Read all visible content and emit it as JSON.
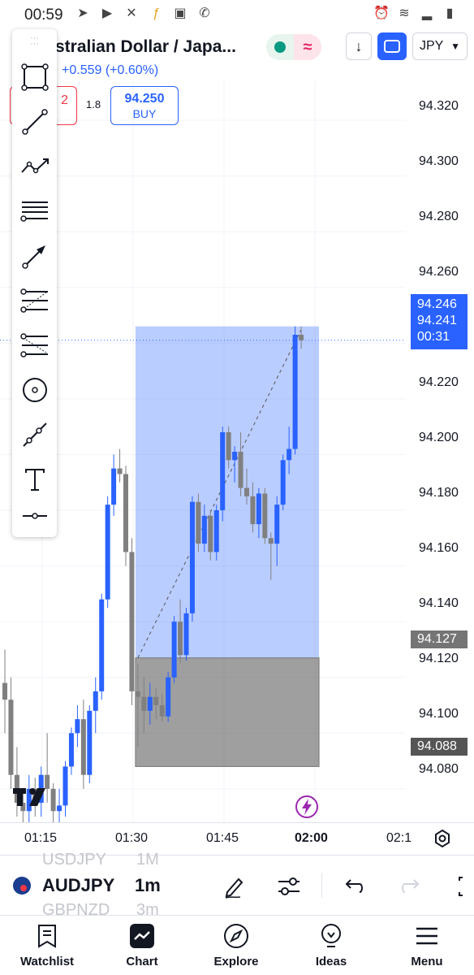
{
  "status": {
    "time": "00:59",
    "left_icons": [
      "telegram-icon",
      "youtube-icon",
      "x-icon",
      "fx-icon",
      "gallery-icon",
      "whatsapp-icon"
    ],
    "right_icons": [
      "alarm-icon",
      "wifi-icon",
      "signal-icon",
      "battery-icon"
    ]
  },
  "header": {
    "symbol_title": "Australian Dollar / Japa...",
    "change": "+0.559 (+0.60%)",
    "currency": "JPY",
    "sell_partial": "2",
    "spread": "1.8",
    "buy_price": "94.250",
    "buy_label": "BUY"
  },
  "toolbar": {
    "tools": [
      "rectangle-tool-icon",
      "trend-line-tool-icon",
      "path-tool-icon",
      "horizontal-lines-tool-icon",
      "arrow-tool-icon",
      "fib-retracement-tool-icon",
      "fib-extension-tool-icon",
      "circle-tool-icon",
      "ray-tool-icon",
      "text-tool-icon",
      "horizontal-ray-tool-icon"
    ]
  },
  "price_axis": {
    "labels": [
      "94.320",
      "94.300",
      "94.280",
      "94.260",
      "94.220",
      "94.200",
      "94.180",
      "94.160",
      "94.140",
      "94.120",
      "94.100",
      "94.080"
    ],
    "tag_high": "94.246",
    "tag_last": "94.241",
    "tag_countdown": "00:31",
    "tag_entry": "94.127",
    "tag_stop": "94.088"
  },
  "time_axis": {
    "labels": [
      "01:15",
      "01:30",
      "01:45",
      "02:00",
      "02:1"
    ]
  },
  "chart_data": {
    "type": "candlestick",
    "interval": "1m",
    "y_range": [
      94.068,
      94.334
    ],
    "up_color": "#2962ff",
    "down_color": "#808080",
    "candles": [
      [
        94.118,
        94.13,
        94.1,
        94.112
      ],
      [
        94.112,
        94.12,
        94.08,
        94.085
      ],
      [
        94.085,
        94.095,
        94.07,
        94.075
      ],
      [
        94.075,
        94.08,
        94.068,
        94.072
      ],
      [
        94.072,
        94.085,
        94.068,
        94.08
      ],
      [
        94.08,
        94.084,
        94.07,
        94.075
      ],
      [
        94.075,
        94.088,
        94.07,
        94.085
      ],
      [
        94.085,
        94.1,
        94.075,
        94.08
      ],
      [
        94.08,
        94.082,
        94.068,
        94.072
      ],
      [
        94.072,
        94.08,
        94.068,
        94.074
      ],
      [
        94.074,
        94.09,
        94.07,
        94.088
      ],
      [
        94.088,
        94.102,
        94.085,
        94.1
      ],
      [
        94.1,
        94.11,
        94.095,
        94.105
      ],
      [
        94.105,
        94.112,
        94.08,
        94.085
      ],
      [
        94.085,
        94.11,
        94.082,
        94.108
      ],
      [
        94.108,
        94.12,
        94.1,
        94.115
      ],
      [
        94.115,
        94.15,
        94.112,
        94.148
      ],
      [
        94.148,
        94.185,
        94.145,
        94.182
      ],
      [
        94.182,
        94.2,
        94.178,
        94.195
      ],
      [
        94.195,
        94.202,
        94.19,
        94.193
      ],
      [
        94.193,
        94.196,
        94.16,
        94.165
      ],
      [
        94.165,
        94.17,
        94.11,
        94.115
      ],
      [
        94.115,
        94.125,
        94.095,
        94.113
      ],
      [
        94.113,
        94.12,
        94.1,
        94.108
      ],
      [
        94.108,
        94.118,
        94.103,
        94.113
      ],
      [
        94.113,
        94.116,
        94.105,
        94.11
      ],
      [
        94.11,
        94.114,
        94.104,
        94.106
      ],
      [
        94.106,
        94.122,
        94.104,
        94.12
      ],
      [
        94.12,
        94.142,
        94.118,
        94.14
      ],
      [
        94.14,
        94.148,
        94.125,
        94.128
      ],
      [
        94.128,
        94.145,
        94.126,
        94.143
      ],
      [
        94.143,
        94.185,
        94.14,
        94.183
      ],
      [
        94.183,
        94.186,
        94.165,
        94.168
      ],
      [
        94.168,
        94.182,
        94.165,
        94.178
      ],
      [
        94.178,
        94.18,
        94.162,
        94.165
      ],
      [
        94.165,
        94.182,
        94.162,
        94.18
      ],
      [
        94.18,
        94.21,
        94.176,
        94.208
      ],
      [
        94.208,
        94.21,
        94.195,
        94.198
      ],
      [
        94.198,
        94.203,
        94.19,
        94.201
      ],
      [
        94.201,
        94.208,
        94.185,
        94.188
      ],
      [
        94.188,
        94.195,
        94.182,
        94.185
      ],
      [
        94.185,
        94.19,
        94.172,
        94.175
      ],
      [
        94.175,
        94.188,
        94.17,
        94.186
      ],
      [
        94.186,
        94.188,
        94.168,
        94.17
      ],
      [
        94.17,
        94.172,
        94.155,
        94.168
      ],
      [
        94.168,
        94.185,
        94.16,
        94.182
      ],
      [
        94.182,
        94.2,
        94.18,
        94.198
      ],
      [
        94.198,
        94.21,
        94.193,
        94.202
      ],
      [
        94.202,
        94.246,
        94.2,
        94.243
      ],
      [
        94.243,
        94.246,
        94.238,
        94.241
      ]
    ],
    "position": {
      "entry": 94.127,
      "target": 94.246,
      "stop": 94.088,
      "start_index": 22,
      "end_index": 49
    }
  },
  "symbol_bar": {
    "prev_symbol": "USDJPY",
    "prev_interval": "1M",
    "symbol": "AUDJPY",
    "interval": "1m",
    "next_symbol": "GBPNZD",
    "next_interval": "3m"
  },
  "nav": {
    "items": [
      {
        "label": "Watchlist",
        "icon": "watchlist-icon"
      },
      {
        "label": "Chart",
        "icon": "chart-icon"
      },
      {
        "label": "Explore",
        "icon": "compass-icon"
      },
      {
        "label": "Ideas",
        "icon": "lightbulb-icon"
      },
      {
        "label": "Menu",
        "icon": "hamburger-icon"
      }
    ]
  }
}
